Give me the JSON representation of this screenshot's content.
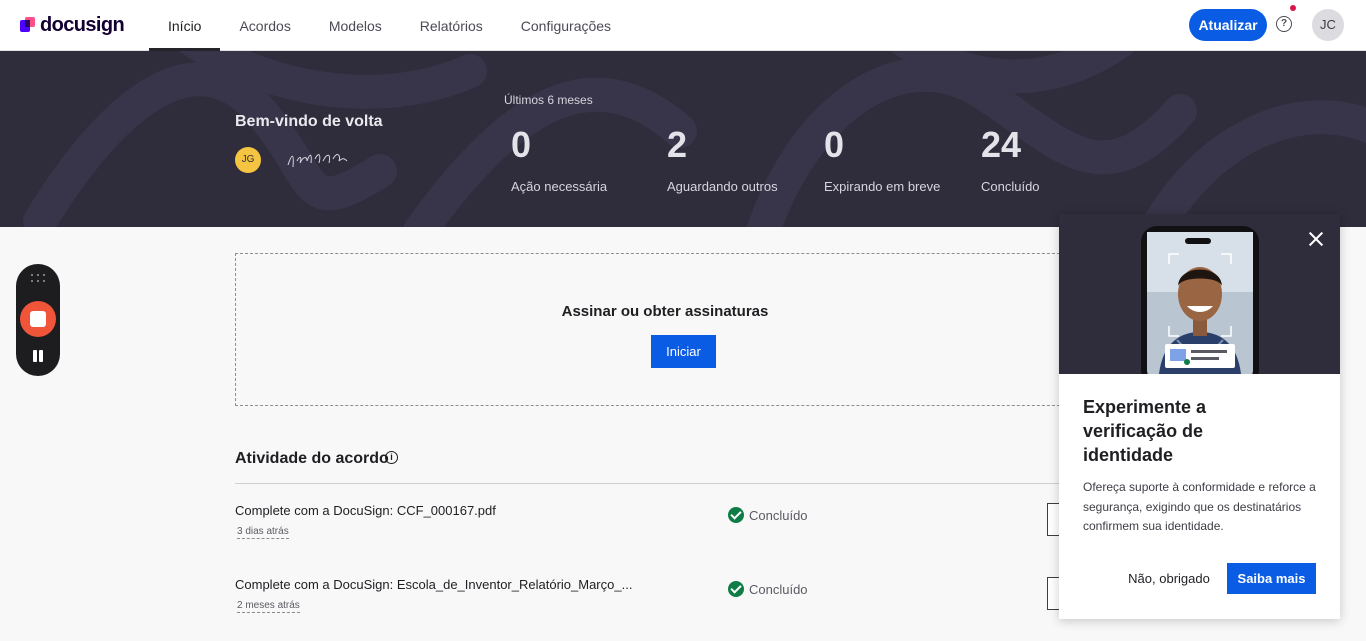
{
  "brand": {
    "logo_text": "docusign"
  },
  "nav": {
    "tabs": [
      {
        "label": "Início"
      },
      {
        "label": "Acordos"
      },
      {
        "label": "Modelos"
      },
      {
        "label": "Relatórios"
      },
      {
        "label": "Configurações"
      }
    ],
    "active_tab": "Início",
    "upgrade_label": "Atualizar",
    "help_glyph": "?",
    "user_initials": "JC"
  },
  "hero": {
    "welcome": "Bem-vindo de volta",
    "user_initials": "JG",
    "period": "Últimos 6 meses",
    "stats": [
      {
        "value": "0",
        "label": "Ação necessária"
      },
      {
        "value": "2",
        "label": "Aguardando outros"
      },
      {
        "value": "0",
        "label": "Expirando em breve"
      },
      {
        "value": "24",
        "label": "Concluído"
      }
    ]
  },
  "sign": {
    "title": "Assinar ou obter assinaturas",
    "start_label": "Iniciar"
  },
  "activity": {
    "title": "Atividade do acordo",
    "info_glyph": "i",
    "rows": [
      {
        "name": "Complete com a DocuSign: CCF_000167.pdf",
        "date": "3 dias atrás",
        "status": "Concluído"
      },
      {
        "name": "Complete com a DocuSign: Escola_de_Inventor_Relatório_Março_...",
        "date": "2 meses atrás",
        "status": "Concluído"
      }
    ]
  },
  "popover": {
    "title": "Experimente a verificação de identidade",
    "description": "Ofereça suporte à conformidade e reforce a segurança, exigindo que os destinatários confirmem sua identidade.",
    "decline_label": "Não, obrigado",
    "learn_more_label": "Saiba mais"
  },
  "colors": {
    "accent": "#0b5ce5",
    "hero_background": "#2f2c3b",
    "success": "#0f7b45",
    "record": "#f0553a"
  }
}
